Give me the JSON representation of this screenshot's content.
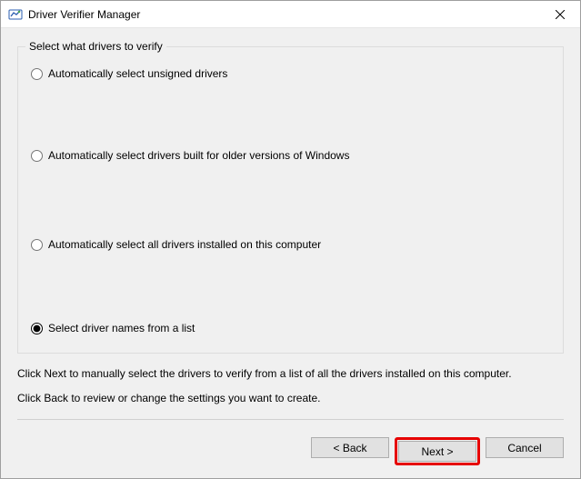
{
  "window": {
    "title": "Driver Verifier Manager"
  },
  "group": {
    "legend": "Select what drivers to verify"
  },
  "options": {
    "opt1": "Automatically select unsigned drivers",
    "opt2": "Automatically select drivers built for older versions of Windows",
    "opt3": "Automatically select all drivers installed on this computer",
    "opt4": "Select driver names from a list"
  },
  "instructions": {
    "line1": "Click Next to manually select the drivers to verify from a list of all the drivers installed on this computer.",
    "line2": "Click Back to review or change the settings you want to create."
  },
  "buttons": {
    "back": "< Back",
    "next": "Next >",
    "cancel": "Cancel"
  }
}
